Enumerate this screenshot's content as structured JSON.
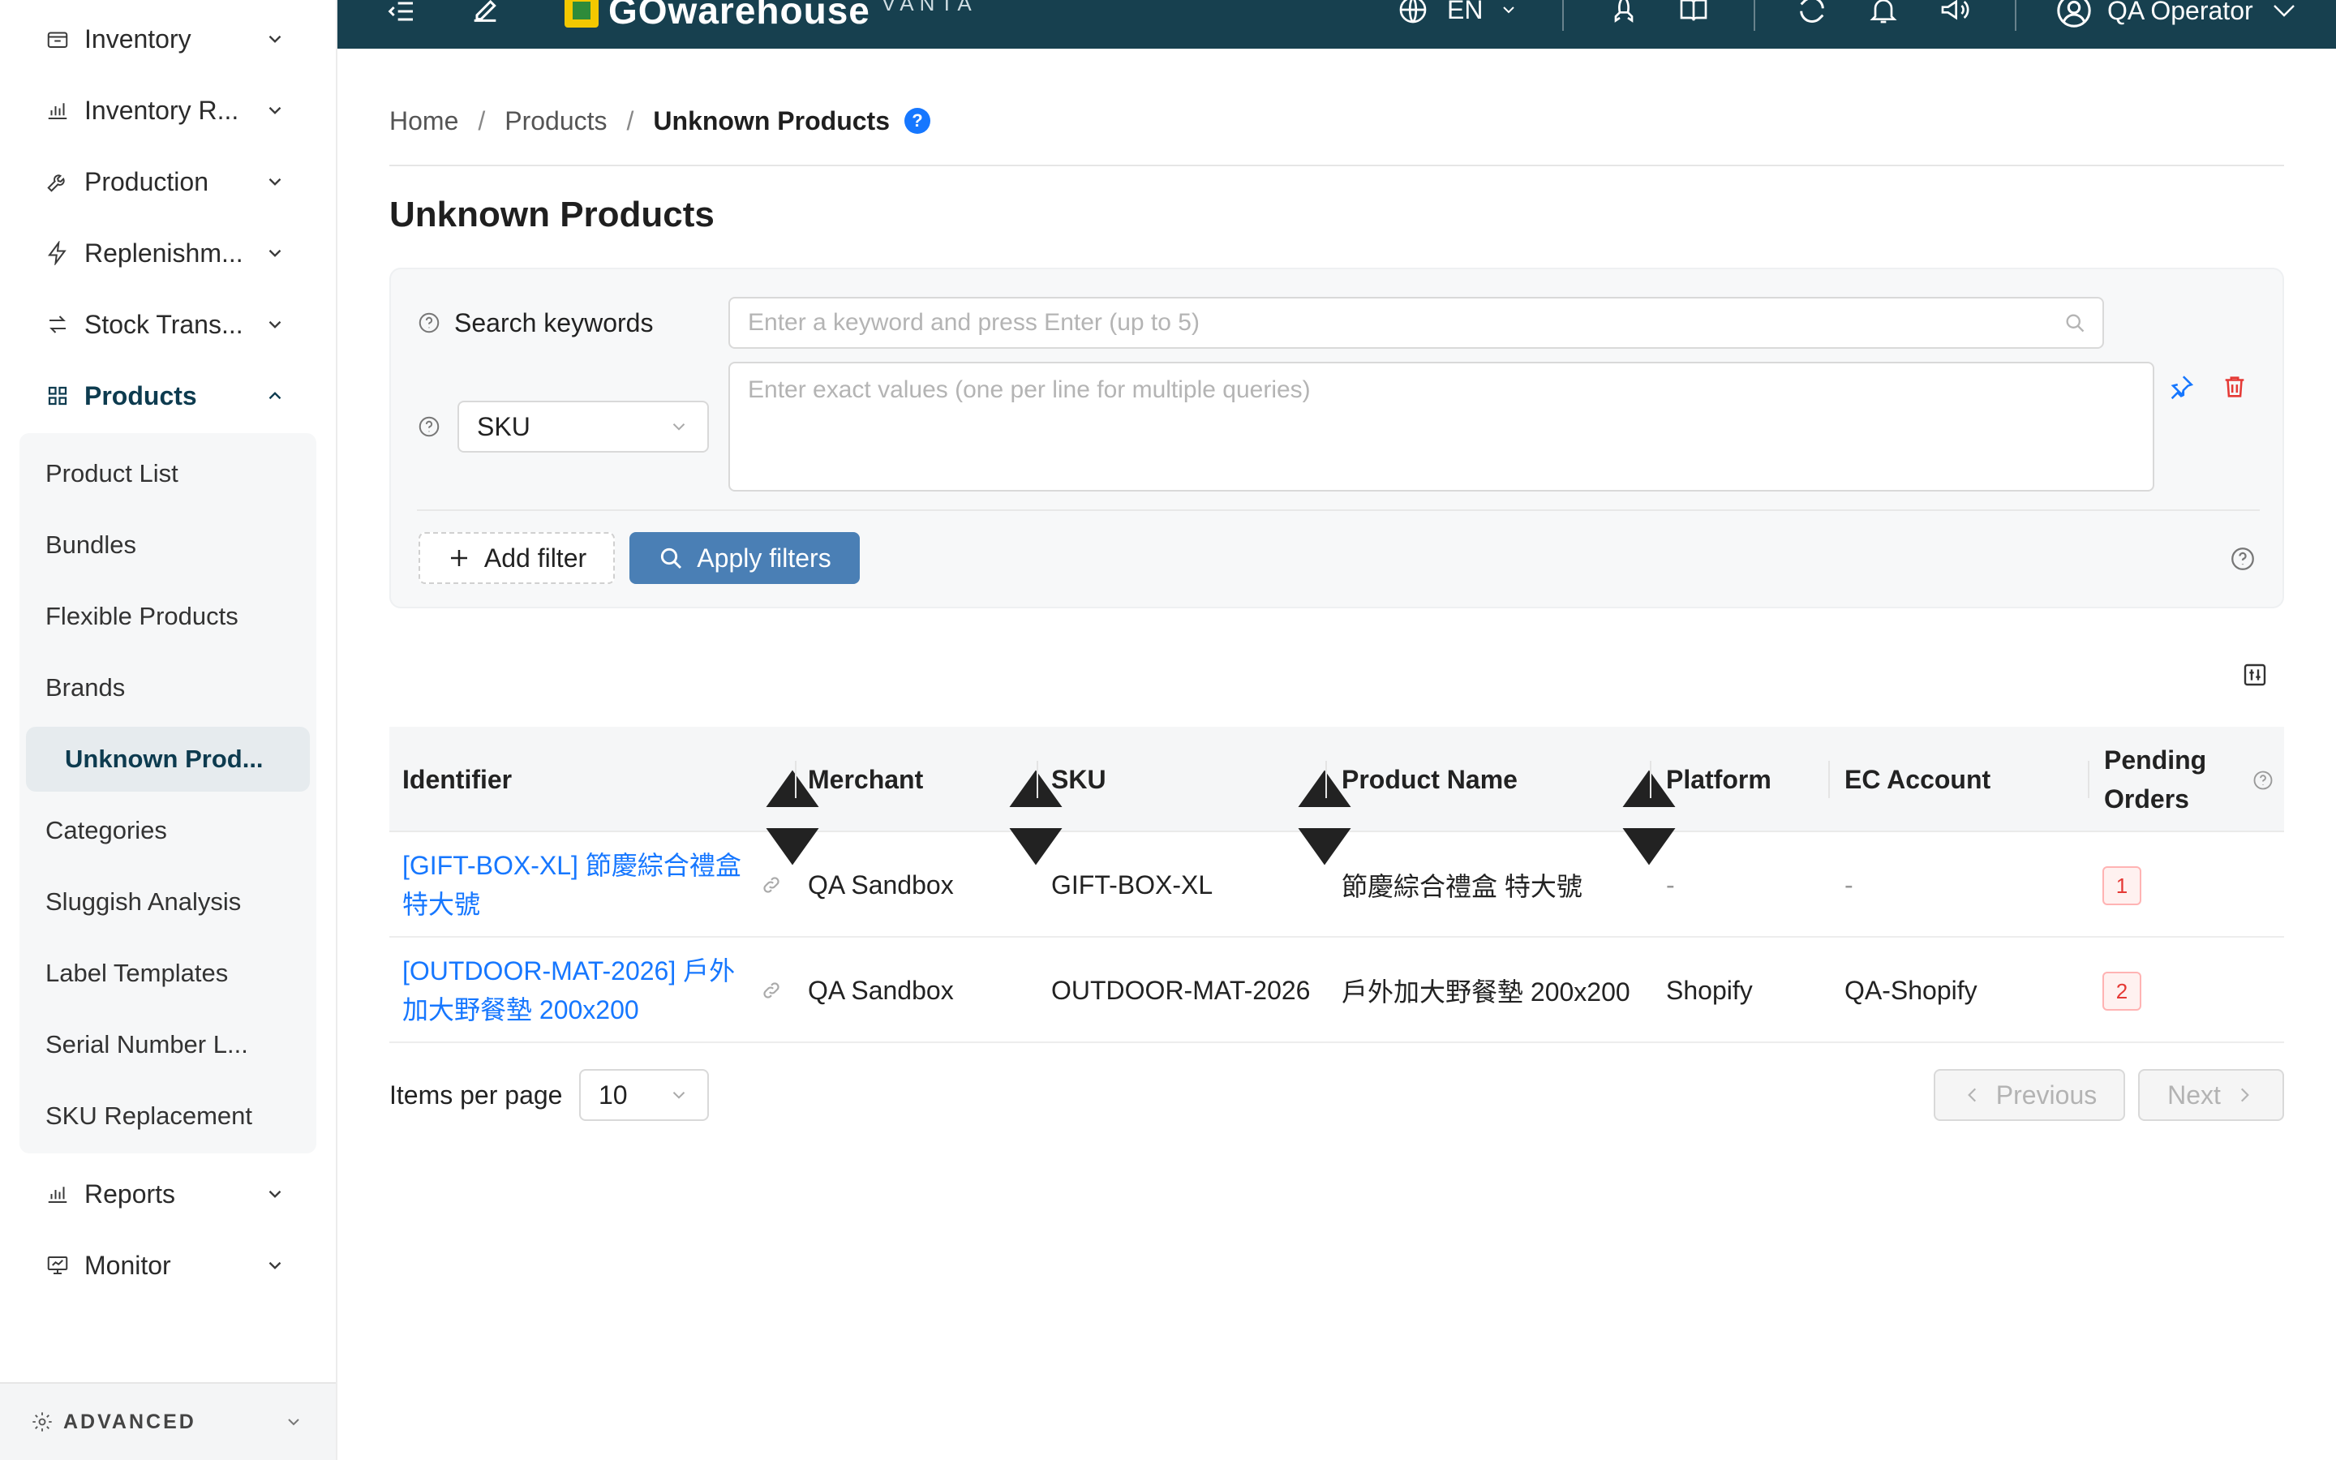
{
  "sidebar": {
    "nav": [
      {
        "label": "Inventory",
        "icon": "inventory-icon"
      },
      {
        "label": "Inventory R...",
        "icon": "bar-chart-icon"
      },
      {
        "label": "Production",
        "icon": "wrench-icon"
      },
      {
        "label": "Replenishm...",
        "icon": "bolt-icon"
      },
      {
        "label": "Stock Trans...",
        "icon": "transfer-icon"
      },
      {
        "label": "Products",
        "icon": "grid-icon"
      }
    ],
    "products_submenu": [
      "Product List",
      "Bundles",
      "Flexible Products",
      "Brands",
      "Unknown Prod...",
      "Categories",
      "Sluggish Analysis",
      "Label Templates",
      "Serial Number L...",
      "SKU Replacement"
    ],
    "nav_after": [
      {
        "label": "Reports",
        "icon": "bar-chart-icon"
      },
      {
        "label": "Monitor",
        "icon": "monitor-icon"
      }
    ],
    "advanced_label": "ADVANCED"
  },
  "topbar": {
    "logo_text": "GOwarehouse",
    "logo_sub": "VANTA",
    "language": "EN",
    "user_name": "QA Operator"
  },
  "breadcrumb": {
    "home": "Home",
    "products": "Products",
    "current": "Unknown Products",
    "help": "?"
  },
  "page_title": "Unknown Products",
  "filters": {
    "search_label": "Search keywords",
    "search_placeholder": "Enter a keyword and press Enter (up to 5)",
    "field_select": "SKU",
    "exact_placeholder": "Enter exact values (one per line for multiple queries)",
    "add_filter": "Add filter",
    "apply_filters": "Apply filters"
  },
  "table": {
    "headers": {
      "identifier": "Identifier",
      "merchant": "Merchant",
      "sku": "SKU",
      "product_name": "Product Name",
      "platform": "Platform",
      "ec_account": "EC Account",
      "pending_orders_1": "Pending",
      "pending_orders_2": "Orders"
    },
    "rows": [
      {
        "identifier_1": "[GIFT-BOX-XL] 節慶綜合禮盒",
        "identifier_2": "特大號",
        "merchant": "QA Sandbox",
        "sku": "GIFT-BOX-XL",
        "product_name": "節慶綜合禮盒 特大號",
        "platform": "-",
        "ec_account": "-",
        "pending_orders": "1"
      },
      {
        "identifier_1": "[OUTDOOR-MAT-2026] 戶外",
        "identifier_2": "加大野餐墊 200x200",
        "merchant": "QA Sandbox",
        "sku": "OUTDOOR-MAT-2026",
        "product_name": "戶外加大野餐墊 200x200",
        "platform": "Shopify",
        "ec_account": "QA-Shopify",
        "pending_orders": "2"
      }
    ]
  },
  "pagination": {
    "items_per_page_label": "Items per page",
    "items_per_page_value": "10",
    "previous": "Previous",
    "next": "Next"
  },
  "colors": {
    "topbar": "#17404f",
    "accent_link": "#1677ff",
    "apply_button": "#4a7fb5",
    "badge_red": "#e53935",
    "active_nav": "#0d3b4f"
  }
}
